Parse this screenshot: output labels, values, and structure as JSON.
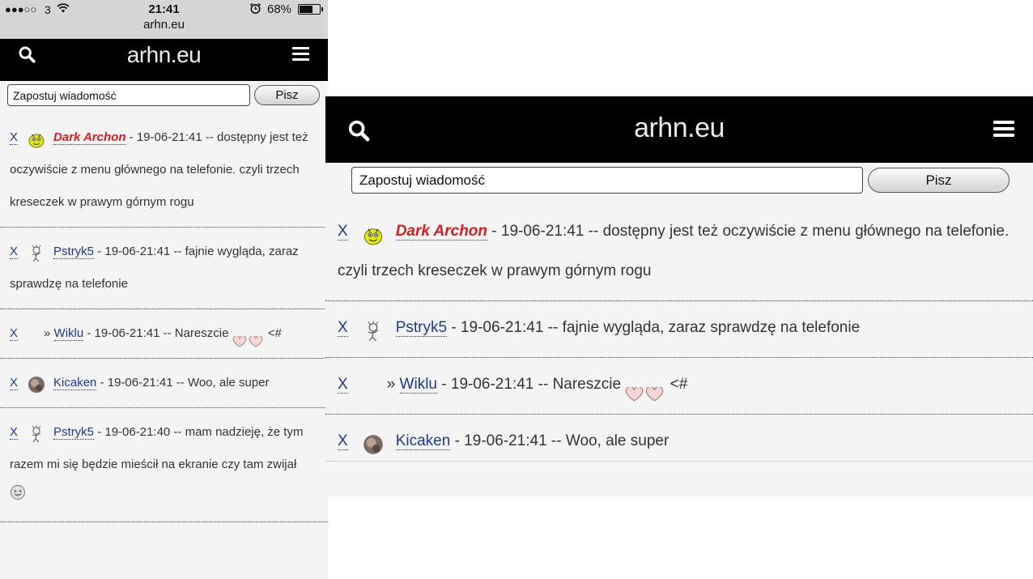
{
  "status_bar": {
    "signal": "●●●○○",
    "carrier": "3",
    "time": "21:41",
    "battery_percent": "68%",
    "battery_level": 0.68,
    "url": "arhn.eu"
  },
  "nav": {
    "title": "arhn.eu",
    "search_icon": "search-icon",
    "menu_icon": "hamburger-menu-icon"
  },
  "compose": {
    "placeholder": "Zapostuj wiadomość",
    "submit_label": "Pisz"
  },
  "colors": {
    "navbar_bg": "#000000",
    "page_bg": "#f4f4f4",
    "username_link": "#1f3a8a",
    "admin_username": "#d41f1f"
  },
  "messages_mobile": [
    {
      "delete": "X",
      "prefix": "",
      "user": "Dark Archon",
      "meta": " - 19-06-21:41 -- dostępny jest też oczywiście z menu głównego na telefonie. czyli trzech kreseczek w prawym górnym rogu"
    },
    {
      "delete": "X",
      "prefix": "",
      "user": "Pstryk5",
      "meta": " - 19-06-21:41 -- fajnie wygląda, zaraz sprawdzę na telefonie"
    },
    {
      "delete": "X",
      "prefix": "» ",
      "user": "Wiklu",
      "meta": " - 19-06-21:41 -- Nareszcie ",
      "suffix": " <#"
    },
    {
      "delete": "X",
      "prefix": "",
      "user": "Kicaken",
      "meta": " - 19-06-21:41 -- Woo, ale super"
    },
    {
      "delete": "X",
      "prefix": "",
      "user": "Pstryk5",
      "meta": " - 19-06-21:40 -- mam nadzieję, że tym razem mi się będzie mieścił na ekranie czy tam zwijał"
    }
  ],
  "messages_desktop": [
    {
      "delete": "X",
      "prefix": "",
      "user": "Dark Archon",
      "meta": " - 19-06-21:41 -- dostępny jest też oczywiście z menu głównego na telefonie. czyli trzech kreseczek w prawym górnym rogu"
    },
    {
      "delete": "X",
      "prefix": "",
      "user": "Pstryk5",
      "meta": " - 19-06-21:41 -- fajnie wygląda, zaraz sprawdzę na telefonie"
    },
    {
      "delete": "X",
      "prefix": "» ",
      "user": "Wiklu",
      "meta": " - 19-06-21:41 -- Nareszcie ",
      "suffix": " <#"
    },
    {
      "delete": "X",
      "prefix": "",
      "user": "Kicaken",
      "meta": " - 19-06-21:41 -- Woo, ale super"
    }
  ]
}
